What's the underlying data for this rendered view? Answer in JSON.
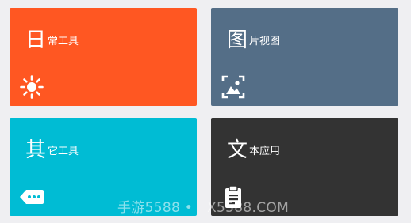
{
  "tiles": [
    {
      "big": "日",
      "rest": "常工具",
      "icon": "sun-icon",
      "color": "#ff5722"
    },
    {
      "big": "图",
      "rest": "片视图",
      "icon": "image-icon",
      "color": "#546e87"
    },
    {
      "big": "其",
      "rest": "它工具",
      "icon": "tag-icon",
      "color": "#00bcd4"
    },
    {
      "big": "文",
      "rest": "本应用",
      "icon": "clipboard-icon",
      "color": "#333333"
    }
  ],
  "watermark": {
    "left": "手游5588 •",
    "right": "X5588.COM"
  }
}
